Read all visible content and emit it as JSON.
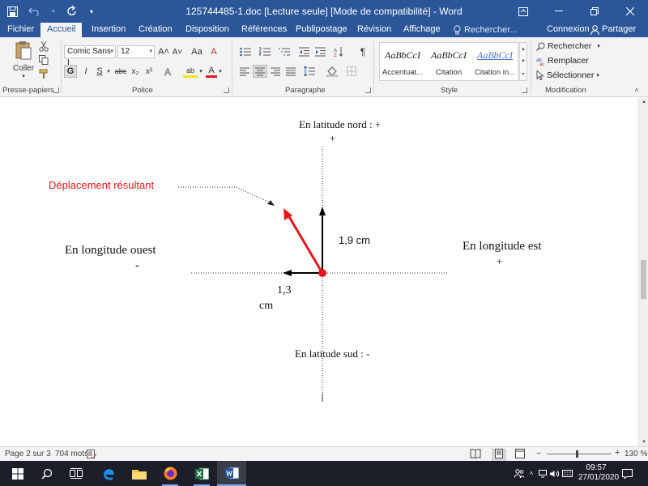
{
  "window": {
    "title": "125744485-1.doc [Lecture seule] [Mode de compatibilité] - Word"
  },
  "tabs": [
    "Fichier",
    "Accueil",
    "Insertion",
    "Création",
    "Disposition",
    "Références",
    "Publipostage",
    "Révision",
    "Affichage"
  ],
  "tab_search": "Rechercher...",
  "account": {
    "signin": "Connexion",
    "share": "Partager"
  },
  "ribbon": {
    "clipboard": {
      "label": "Presse-papiers",
      "paste": "Coller"
    },
    "font": {
      "label": "Police",
      "font_name": "Comic Sans I",
      "font_size": "12",
      "bold": "G",
      "italic": "I",
      "underline": "S",
      "strike": "abc",
      "subscript": "x₂",
      "superscript": "x²",
      "grow": "A˄",
      "shrink": "A˅",
      "case": "Aa",
      "clear": "A",
      "highlight": "ab",
      "color": "A"
    },
    "paragraph": {
      "label": "Paragraphe",
      "pilcrow": "¶"
    },
    "styles": {
      "label": "Style",
      "items": [
        {
          "sample": "AaBbCcI",
          "name": "Accentuat..."
        },
        {
          "sample": "AaBbCcI",
          "name": "Citation"
        },
        {
          "sample": "AaBbCcI",
          "name": "Citation in..."
        }
      ]
    },
    "editing": {
      "label": "Modification",
      "find": "Rechercher",
      "replace": "Remplacer",
      "select": "Sélectionner"
    }
  },
  "document": {
    "north": "En latitude nord : +",
    "north_plus": "+",
    "south": "En latitude sud : -",
    "west": "En longitude ouest",
    "west_minus": "-",
    "east": "En longitude est",
    "east_plus": "+",
    "resultant": "Déplacement   résultant",
    "label_vertical": "1,9 cm",
    "label_horizontal_1": "1,3",
    "label_horizontal_2": "cm",
    "colors": {
      "resultant": "#e8141b",
      "axis": "#000000"
    }
  },
  "status": {
    "page": "Page 2 sur 3",
    "words": "704 mots",
    "zoom": "130 %",
    "zoom_level": 1.3
  },
  "taskbar": {
    "time": "09:57",
    "date": "27/01/2020"
  }
}
